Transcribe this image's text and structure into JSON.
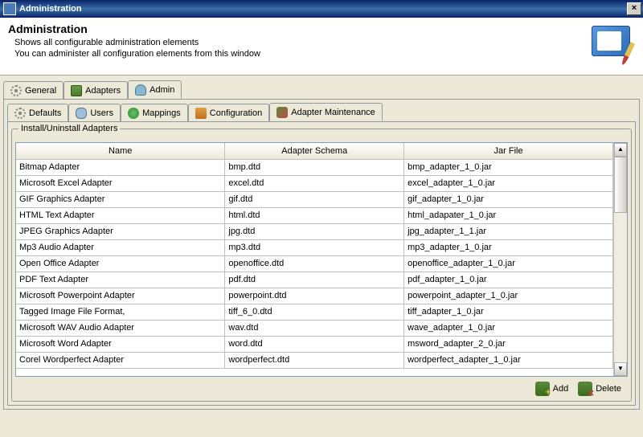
{
  "window": {
    "title": "Administration"
  },
  "header": {
    "title": "Administration",
    "line1": "Shows all configurable administration elements",
    "line2": "You can administer all configuration elements from this window"
  },
  "main_tabs": [
    {
      "label": "General",
      "active": false
    },
    {
      "label": "Adapters",
      "active": false
    },
    {
      "label": "Admin",
      "active": true
    }
  ],
  "sub_tabs": [
    {
      "label": "Defaults",
      "active": false
    },
    {
      "label": "Users",
      "active": false
    },
    {
      "label": "Mappings",
      "active": false
    },
    {
      "label": "Configuration",
      "active": false
    },
    {
      "label": "Adapter Maintenance",
      "active": true
    }
  ],
  "fieldset_title": "Install/Uninstall Adapters",
  "columns": [
    "Name",
    "Adapter Schema",
    "Jar File"
  ],
  "rows": [
    {
      "name": "Bitmap Adapter",
      "schema": "bmp.dtd",
      "jar": "bmp_adapter_1_0.jar"
    },
    {
      "name": "Microsoft Excel Adapter",
      "schema": "excel.dtd",
      "jar": "excel_adapter_1_0.jar"
    },
    {
      "name": "GIF Graphics Adapter",
      "schema": "gif.dtd",
      "jar": "gif_adapter_1_0.jar"
    },
    {
      "name": "HTML Text Adapter",
      "schema": "html.dtd",
      "jar": "html_adapater_1_0.jar"
    },
    {
      "name": "JPEG Graphics Adapter",
      "schema": "jpg.dtd",
      "jar": "jpg_adapter_1_1.jar"
    },
    {
      "name": "Mp3 Audio Adapter",
      "schema": "mp3.dtd",
      "jar": "mp3_adapter_1_0.jar"
    },
    {
      "name": "Open Office Adapter",
      "schema": "openoffice.dtd",
      "jar": "openoffice_adapter_1_0.jar"
    },
    {
      "name": "PDF Text Adapter",
      "schema": "pdf.dtd",
      "jar": "pdf_adapter_1_0.jar"
    },
    {
      "name": "Microsoft Powerpoint Adapter",
      "schema": "powerpoint.dtd",
      "jar": "powerpoint_adapter_1_0.jar"
    },
    {
      "name": "Tagged Image File Format,",
      "schema": "tiff_6_0.dtd",
      "jar": "tiff_adapter_1_0.jar"
    },
    {
      "name": "Microsoft WAV Audio Adapter",
      "schema": "wav.dtd",
      "jar": "wave_adapter_1_0.jar"
    },
    {
      "name": "Microsoft Word Adapter",
      "schema": "word.dtd",
      "jar": "msword_adapter_2_0.jar"
    },
    {
      "name": "Corel Wordperfect Adapter",
      "schema": "wordperfect.dtd",
      "jar": "wordperfect_adapter_1_0.jar"
    }
  ],
  "buttons": {
    "add": "Add",
    "delete": "Delete"
  }
}
